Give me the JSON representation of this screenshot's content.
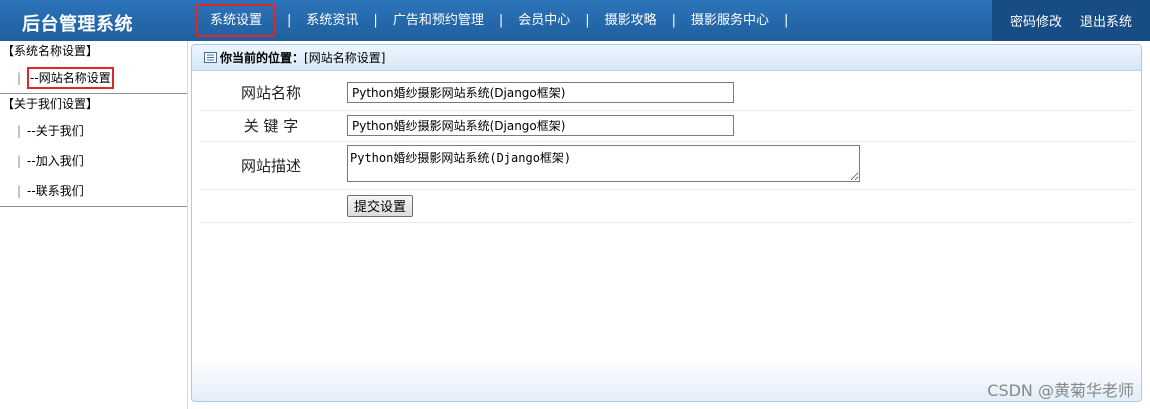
{
  "header": {
    "brand": "后台管理系统",
    "nav": [
      "系统设置",
      "系统资讯",
      "广告和预约管理",
      "会员中心",
      "摄影攻略",
      "摄影服务中心"
    ],
    "separator": "|",
    "right": [
      "密码修改",
      "退出系统"
    ]
  },
  "sidebar": {
    "groups": [
      {
        "title": "【系统名称设置】",
        "items": [
          "--网站名称设置"
        ]
      },
      {
        "title": "【关于我们设置】",
        "items": [
          "--关于我们",
          "--加入我们",
          "--联系我们"
        ]
      }
    ],
    "pipe": "|"
  },
  "main": {
    "location_label": "你当前的位置：",
    "location_value": "[网站名称设置]",
    "fields": {
      "site_name_label": "网站名称",
      "site_name_value": "Python婚纱摄影网站系统(Django框架)",
      "keywords_label": "关 键 字",
      "keywords_value": "Python婚纱摄影网站系统(Django框架)",
      "description_label": "网站描述",
      "description_value": "Python婚纱摄影网站系统(Django框架)"
    },
    "submit_label": "提交设置"
  },
  "watermark": "CSDN @黄菊华老师",
  "colors": {
    "topbar": "#1f5f9f",
    "highlight": "#e0262a",
    "panel_border": "#a9cbe6"
  }
}
